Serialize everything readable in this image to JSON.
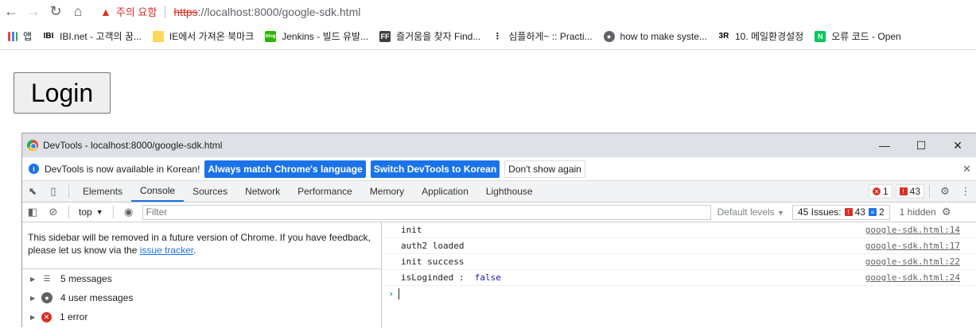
{
  "browser": {
    "security_label": "주의 요함",
    "url_scheme": "https",
    "url_rest": "://localhost:8000/google-sdk.html",
    "bookmarks": [
      {
        "icon": "apps-icon",
        "label": "앱"
      },
      {
        "icon": "ibi-icon",
        "label": "IBI.net - 고객의 꿈..."
      },
      {
        "icon": "folder-icon",
        "label": "IE에서 가져온 북마크"
      },
      {
        "icon": "blog-icon",
        "label": "Jenkins - 빌드 유발..."
      },
      {
        "icon": "ff-icon",
        "label": "즐거움을 찾자 Find..."
      },
      {
        "icon": "dots-icon",
        "label": "심플하게~ :: Practi..."
      },
      {
        "icon": "globe-icon",
        "label": "how to make syste..."
      },
      {
        "icon": "3r-icon",
        "label": "10. 메일환경설정"
      },
      {
        "icon": "n-icon",
        "label": "오류 코드 - Open"
      }
    ]
  },
  "page": {
    "login_label": "Login"
  },
  "devtools": {
    "window_title": "DevTools - localhost:8000/google-sdk.html",
    "infobar": {
      "message": "DevTools is now available in Korean!",
      "btn_match": "Always match Chrome's language",
      "btn_switch": "Switch DevTools to Korean",
      "btn_dismiss": "Don't show again"
    },
    "tabs": [
      "Elements",
      "Console",
      "Sources",
      "Network",
      "Performance",
      "Memory",
      "Application",
      "Lighthouse"
    ],
    "active_tab": "Console",
    "error_count": "1",
    "warning_count": "43",
    "context": "top",
    "filter_placeholder": "Filter",
    "levels_label": "Default levels",
    "issues_label": "45 Issues:",
    "issues_warn": "43",
    "issues_info": "2",
    "hidden_label": "1 hidden",
    "sidebar": {
      "note_text": "This sidebar will be removed in a future version of Chrome. If you have feedback, please let us know via the ",
      "note_link": "issue tracker",
      "note_end": ".",
      "items": [
        {
          "label": "5 messages"
        },
        {
          "label": "4 user messages"
        },
        {
          "label": "1 error"
        }
      ]
    },
    "console_logs": [
      {
        "msg": "init",
        "src": "google-sdk.html:14"
      },
      {
        "msg": "auth2 loaded",
        "src": "google-sdk.html:17"
      },
      {
        "msg": "init success",
        "src": "google-sdk.html:22"
      },
      {
        "msg": "isLoginded :  ",
        "value": "false",
        "src": "google-sdk.html:24"
      }
    ]
  }
}
